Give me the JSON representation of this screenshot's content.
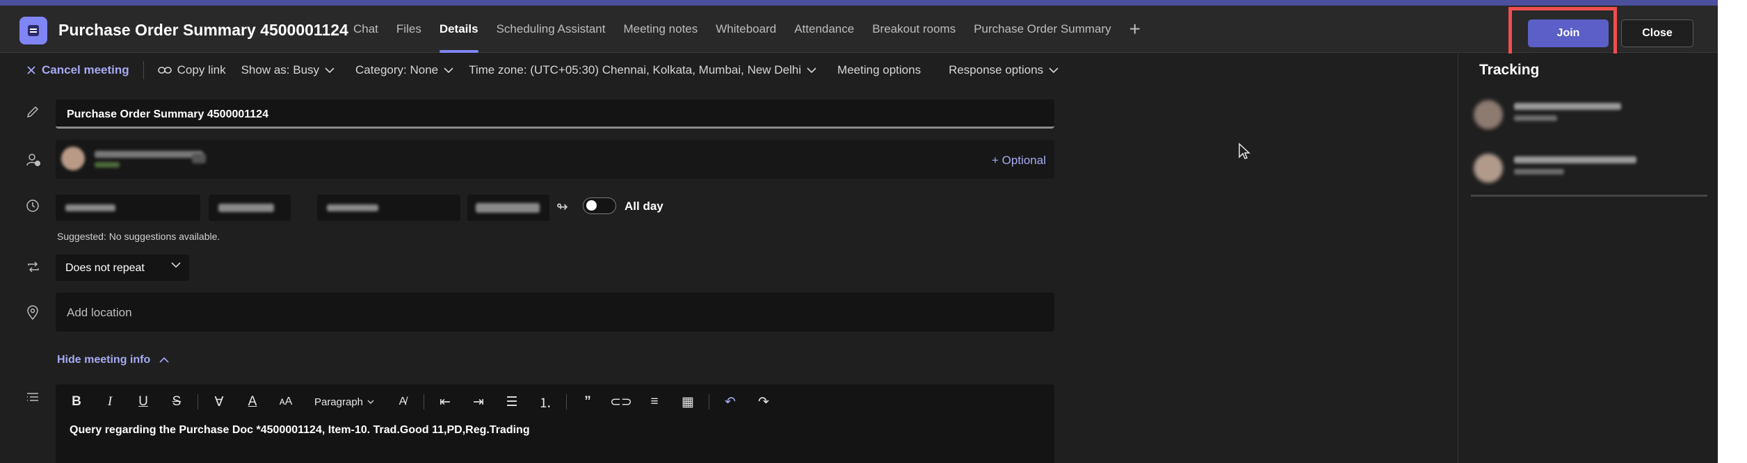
{
  "header": {
    "title": "Purchase Order Summary 4500001124",
    "tabs": [
      {
        "label": "Chat",
        "active": false
      },
      {
        "label": "Files",
        "active": false
      },
      {
        "label": "Details",
        "active": true
      },
      {
        "label": "Scheduling Assistant",
        "active": false
      },
      {
        "label": "Meeting notes",
        "active": false
      },
      {
        "label": "Whiteboard",
        "active": false
      },
      {
        "label": "Attendance",
        "active": false
      },
      {
        "label": "Breakout rooms",
        "active": false
      },
      {
        "label": "Purchase Order Summary",
        "active": false
      }
    ],
    "add_tab": "+",
    "join_label": "Join",
    "close_label": "Close"
  },
  "toolbar": {
    "cancel_meeting": "Cancel meeting",
    "copy_link": "Copy link",
    "show_as": "Show as: Busy",
    "category": "Category: None",
    "time_zone": "Time zone: (UTC+05:30) Chennai, Kolkata, Mumbai, New Delhi",
    "meeting_options": "Meeting options",
    "response_options": "Response options"
  },
  "form": {
    "title_value": "Purchase Order Summary 4500001124",
    "attendees_optional": "+ Optional",
    "all_day_label": "All day",
    "all_day_on": false,
    "suggested": "Suggested: No suggestions available.",
    "repeat_value": "Does not repeat",
    "location_placeholder": "Add location",
    "hide_meeting_info": "Hide meeting info",
    "editor_paragraph": "Paragraph",
    "editor_body": "Query regarding the Purchase Doc *4500001124, Item-10. Trad.Good 11,PD,Reg.Trading"
  },
  "tracking": {
    "title": "Tracking"
  },
  "colors": {
    "accent": "#5b5fc7",
    "link": "#a7aaf2",
    "highlight": "#ef4f4f"
  }
}
